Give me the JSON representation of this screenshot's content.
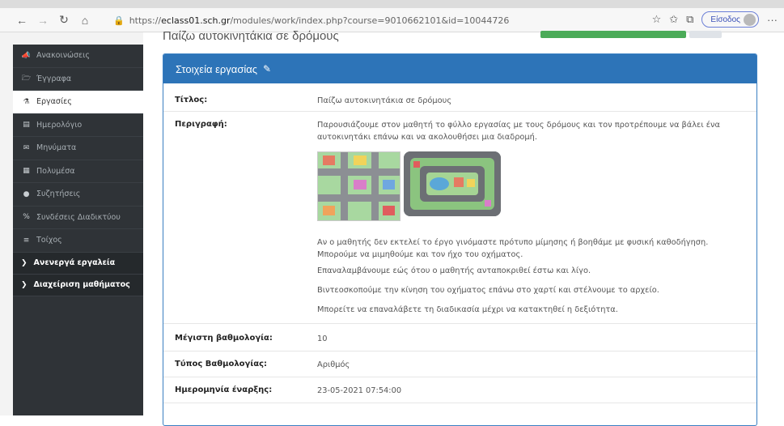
{
  "browser": {
    "url_prefix": "https://",
    "url_host": "eclass01.sch.gr",
    "url_rest": "/modules/work/index.php?course=9010662101&id=10044726",
    "signin_label": "Είσοδος"
  },
  "page": {
    "title": "Παίζω αυτοκινητάκια σε δρόμους"
  },
  "sidebar": {
    "items": [
      {
        "label": "Ανακοινώσεις",
        "icon": "megaphone-icon",
        "glyph": "📣"
      },
      {
        "label": "Έγγραφα",
        "icon": "folder-icon",
        "glyph": "🗁"
      },
      {
        "label": "Εργασίες",
        "icon": "flask-icon",
        "glyph": "⚗"
      },
      {
        "label": "Ημερολόγιο",
        "icon": "calendar-icon",
        "glyph": "▤"
      },
      {
        "label": "Μηνύματα",
        "icon": "envelope-icon",
        "glyph": "✉"
      },
      {
        "label": "Πολυμέσα",
        "icon": "film-icon",
        "glyph": "▦"
      },
      {
        "label": "Συζητήσεις",
        "icon": "chat-icon",
        "glyph": "●"
      },
      {
        "label": "Συνδέσεις Διαδικτύου",
        "icon": "link-icon",
        "glyph": "%"
      },
      {
        "label": "Τοίχος",
        "icon": "list-icon",
        "glyph": "≡"
      }
    ],
    "groups": [
      {
        "label": "Ανενεργά εργαλεία",
        "icon": "chevron-right-icon",
        "glyph": "❯"
      },
      {
        "label": "Διαχείριση μαθήματος",
        "icon": "chevron-right-icon",
        "glyph": "❯"
      }
    ]
  },
  "panel": {
    "heading": "Στοιχεία εργασίας",
    "fields": {
      "title_label": "Τίτλος:",
      "title_value": "Παίζω αυτοκινητάκια σε δρόμους",
      "desc_label": "Περιγραφή:",
      "desc_line1": "Παρουσιάζουμε στον μαθητή το φύλλο εργασίας με τους δρόμους και τον προτρέπουμε να βάλει ένα",
      "desc_line2": "αυτοκινητάκι επάνω και να ακολουθήσει μια διαδρομή.",
      "desc_p1_line1": "Αν ο μαθητής δεν εκτελεί το έργο γινόμαστε πρότυπο μίμησης ή βοηθάμε με φυσική καθοδήγηση.",
      "desc_p1_line2": "Μπορούμε να μιμηθούμε και τον ήχο του οχήματος.",
      "desc_p2": "Επαναλαμβάνουμε εώς ότου ο μαθητής ανταποκριθεί έστω και λίγο.",
      "desc_p3": "Βιντεοσκοπούμε την κίνηση του οχήματος επάνω στο χαρτί και στέλνουμε το αρχείο.",
      "desc_p4": "Μπορείτε να επαναλάβετε τη διαδικασία μέχρι να κατακτηθεί η δεξιότητα.",
      "max_grade_label": "Μέγιστη βαθμολογία:",
      "max_grade_value": "10",
      "grade_type_label": "Τύπος Βαθμολογίας:",
      "grade_type_value": "Αριθμός",
      "start_label": "Ημερομηνία έναρξης:",
      "start_value": "23-05-2021 07:54:00"
    }
  }
}
